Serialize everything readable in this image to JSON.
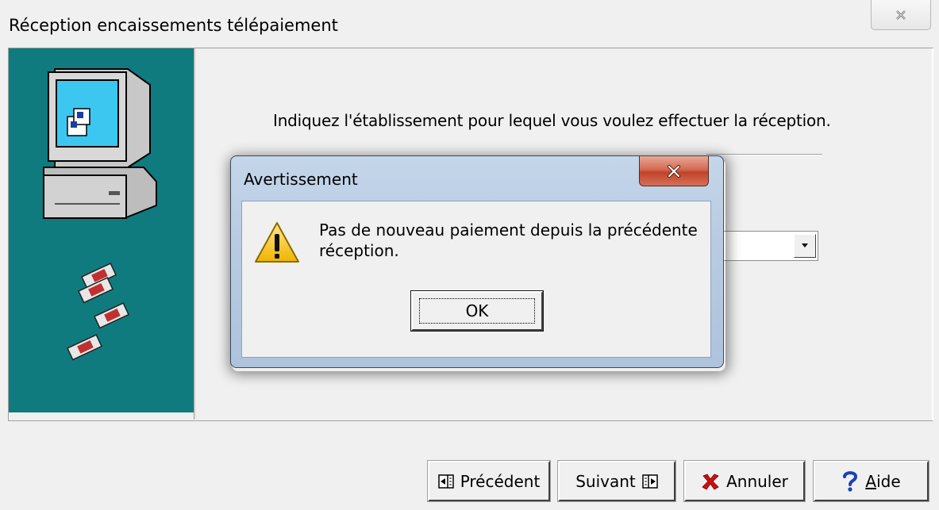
{
  "window": {
    "title": "Réception encaissements télépaiement"
  },
  "main": {
    "instruction": "Indiquez l'établissement pour lequel vous voulez effectuer la réception.",
    "establishment_select_value": ""
  },
  "buttons": {
    "previous": "Précédent",
    "next": "Suivant",
    "cancel": "Annuler",
    "help_underlined": "A",
    "help_rest": "ide"
  },
  "dialog": {
    "title": "Avertissement",
    "message": "Pas de nouveau paiement depuis la précédente réception.",
    "ok": "OK"
  },
  "colors": {
    "teal_panel": "#0f7b7f",
    "window_bg": "#f0f0f0",
    "dialog_frame": "#b8cbe2",
    "close_red": "#c0432a",
    "cancel_red": "#cc1111",
    "help_blue": "#1a3fbf"
  },
  "icons": {
    "sidebar": [
      "computer-icon",
      "diskette-icon"
    ],
    "dialog": [
      "warning-icon",
      "close-icon"
    ],
    "buttons": [
      "previous-icon",
      "next-icon",
      "cancel-x-icon",
      "help-question-icon"
    ]
  }
}
